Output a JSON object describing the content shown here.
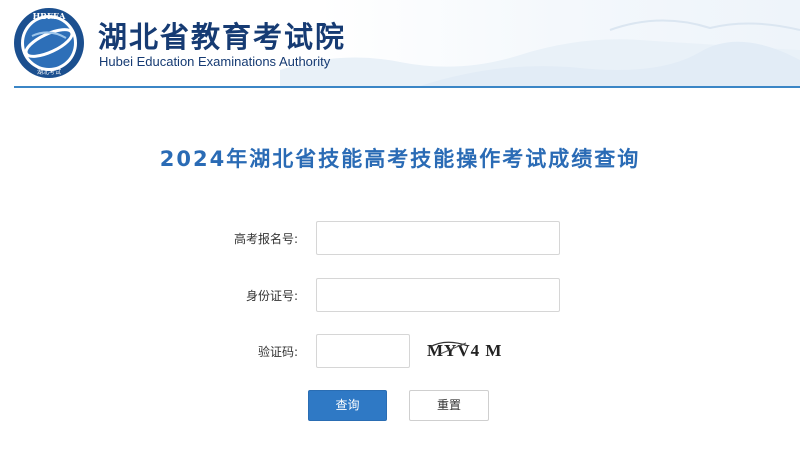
{
  "header": {
    "logo_text": "HBEEA",
    "logo_subtext": "湖北考试",
    "org_name_cn": "湖北省教育考试院",
    "org_name_en": "Hubei Education Examinations Authority"
  },
  "page_title": "2024年湖北省技能高考技能操作考试成绩查询",
  "form": {
    "exam_number": {
      "label": "高考报名号:",
      "value": "",
      "placeholder": ""
    },
    "id_number": {
      "label": "身份证号:",
      "value": "",
      "placeholder": ""
    },
    "captcha": {
      "label": "验证码:",
      "value": "",
      "placeholder": "",
      "image_text": "MYV4 M"
    }
  },
  "buttons": {
    "query_label": "查询",
    "reset_label": "重置"
  },
  "colors": {
    "brand_dark": "#163b73",
    "accent": "#2f79c5",
    "title": "#2a6bb5",
    "divider": "#3b86c6"
  }
}
